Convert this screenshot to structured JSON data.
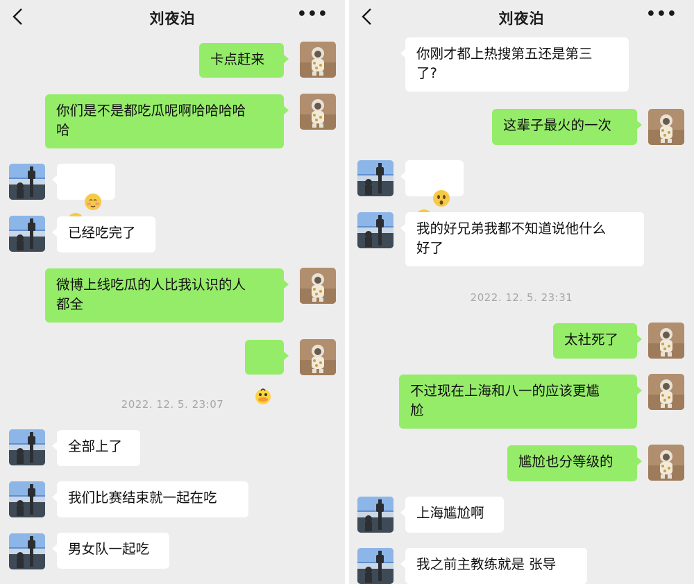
{
  "left": {
    "title": "刘夜泊",
    "messages": [
      {
        "text": "卡点赶来"
      },
      {
        "text": "你们是不是都吃瓜呢啊哈哈哈哈\n哈"
      },
      {
        "text": "已经吃完了"
      },
      {
        "text": "微博上线吃瓜的人比我认识的人\n都全"
      },
      {
        "text": "全部上了"
      },
      {
        "text": "我们比赛结束就一起在吃"
      },
      {
        "text": "男女队一起吃"
      }
    ],
    "timestamp": "2022. 12. 5. 23:07"
  },
  "right": {
    "title": "刘夜泊",
    "messages": [
      {
        "text": "你刚才都上热搜第五还是第三\n了?"
      },
      {
        "text": "这辈子最火的一次"
      },
      {
        "text": "我的好兄弟我都不知道说他什么\n好了"
      },
      {
        "text": "太社死了"
      },
      {
        "text": "不过现在上海和八一的应该更尴\n尬"
      },
      {
        "text": "尴尬也分等级的"
      },
      {
        "text": "上海尴尬啊"
      },
      {
        "text": "我之前主教练就是 张导"
      }
    ],
    "timestamp": "2022. 12. 5. 23:31"
  },
  "colors": {
    "sent_bubble": "#95ec69",
    "received_bubble": "#ffffff",
    "background": "#ededed",
    "timestamp": "#a6a6a6"
  },
  "icons": {
    "back": "chevron-left-icon",
    "more": "more-dots-icon"
  }
}
